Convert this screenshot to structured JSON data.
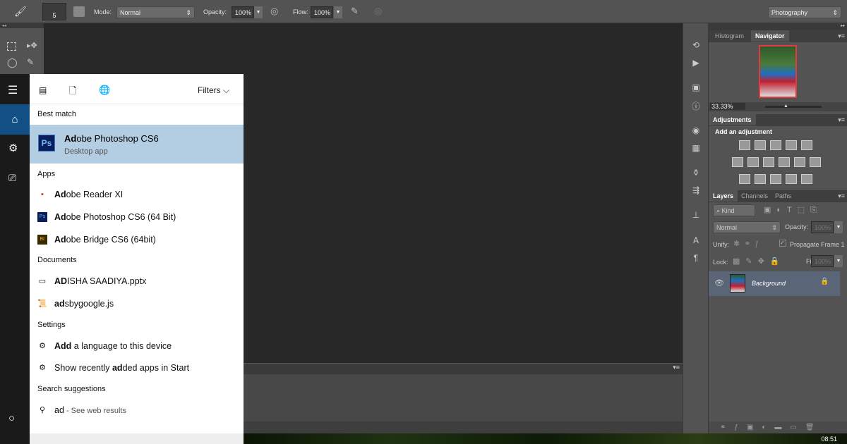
{
  "options_bar": {
    "brush_size": "5",
    "mode_label": "Mode:",
    "mode_value": "Normal",
    "opacity_label": "Opacity:",
    "opacity_value": "100%",
    "flow_label": "Flow:",
    "flow_value": "100%",
    "workspace": "Photography"
  },
  "navigator": {
    "tabs": [
      "Histogram",
      "Navigator"
    ],
    "zoom": "33.33%"
  },
  "adjustments": {
    "tab": "Adjustments",
    "title": "Add an adjustment"
  },
  "layers": {
    "tabs": [
      "Layers",
      "Channels",
      "Paths"
    ],
    "filter_kind": "Kind",
    "blend_mode": "Normal",
    "opacity_label": "Opacity:",
    "opacity_value": "100%",
    "unify_label": "Unify:",
    "propagate_label": "Propagate Frame 1",
    "lock_label": "Lock:",
    "fill_label": "Fill:",
    "fill_value": "100%",
    "layer_name": "Background"
  },
  "start_menu": {
    "filters_label": "Filters",
    "best_match_header": "Best match",
    "best_match": {
      "bold": "Ad",
      "rest": "obe Photoshop CS6",
      "subtitle": "Desktop app"
    },
    "apps_header": "Apps",
    "apps": [
      {
        "bold": "Ad",
        "rest": "obe Reader XI"
      },
      {
        "bold": "Ad",
        "rest": "obe Photoshop CS6 (64 Bit)"
      },
      {
        "bold": "Ad",
        "rest": "obe Bridge CS6 (64bit)"
      }
    ],
    "documents_header": "Documents",
    "documents": [
      {
        "bold": "AD",
        "rest": "ISHA SAADIYA.pptx"
      },
      {
        "bold": "ad",
        "rest": "sbygoogle.js"
      }
    ],
    "settings_header": "Settings",
    "settings": [
      {
        "pre": "",
        "bold": "Add",
        "rest": " a language to this device"
      },
      {
        "pre": "Show recently ",
        "bold": "ad",
        "rest": "ded apps in Start"
      }
    ],
    "suggestions_header": "Search suggestions",
    "suggestion": {
      "query": "ad",
      "hint": " - See web results"
    }
  },
  "taskbar": {
    "time": "08:51"
  }
}
